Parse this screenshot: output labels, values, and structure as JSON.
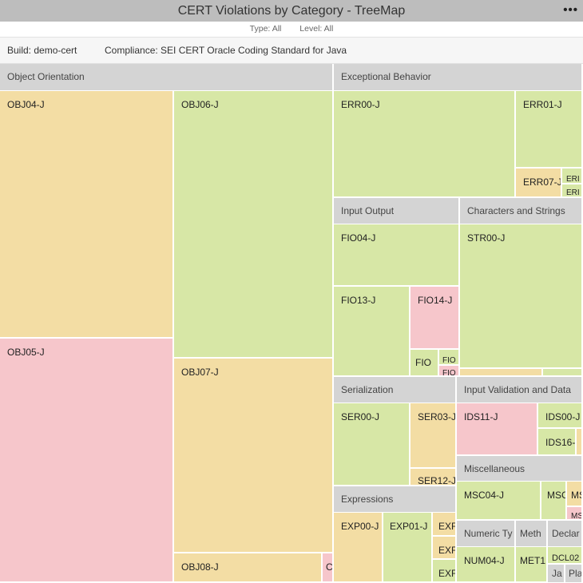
{
  "title": "CERT Violations by Category - TreeMap",
  "menu_icon": "more-dots-icon",
  "filters": {
    "type": "Type: All",
    "level": "Level: All"
  },
  "info": {
    "build": "Build: demo-cert",
    "compliance": "Compliance: SEI CERT Oracle Coding Standard for Java"
  },
  "colors": {
    "green": "#d7e7a6",
    "orange": "#f3dda4",
    "pink": "#f6c6cb",
    "header": "#d4d4d4"
  },
  "categories": {
    "object_orientation": "Object Orientation",
    "exceptional_behavior": "Exceptional Behavior",
    "input_output": "Input Output",
    "characters_strings": "Characters and Strings",
    "serialization": "Serialization",
    "input_validation": "Input Validation and Data",
    "expressions": "Expressions",
    "miscellaneous": "Miscellaneous",
    "numeric": "Numeric Ty",
    "methods": "Meth",
    "declarations": "Declar"
  },
  "cells": {
    "obj04": "OBJ04-J",
    "obj06": "OBJ06-J",
    "obj05": "OBJ05-J",
    "obj07": "OBJ07-J",
    "obj08": "OBJ08-J",
    "obj_small": "C",
    "err00": "ERR00-J",
    "err01": "ERR01-J",
    "err07": "ERR07-J",
    "err_a": "ERI",
    "err_b": "ERI",
    "fio04": "FIO04-J",
    "fio13": "FIO13-J",
    "fio14": "FIO14-J",
    "fio_a": "FIO",
    "fio_b": "FIO",
    "fio_c": "FIO",
    "str00": "STR00-J",
    "ser00": "SER00-J",
    "ser03": "SER03-J",
    "ser12": "SER12-J",
    "ids11": "IDS11-J",
    "ids00": "IDS00-J",
    "ids16": "IDS16-",
    "exp00": "EXP00-J",
    "exp01": "EXP01-J",
    "exp_a": "EXF",
    "exp_b": "EXF",
    "exp_c": "EXF",
    "msc04": "MSC04-J",
    "msc_a": "MSC",
    "msc_b": "MS",
    "msc_c": "MS",
    "num04": "NUM04-J",
    "met1": "MET1",
    "dcl02": "DCL02",
    "ja": "Ja",
    "pla": "Pla"
  }
}
